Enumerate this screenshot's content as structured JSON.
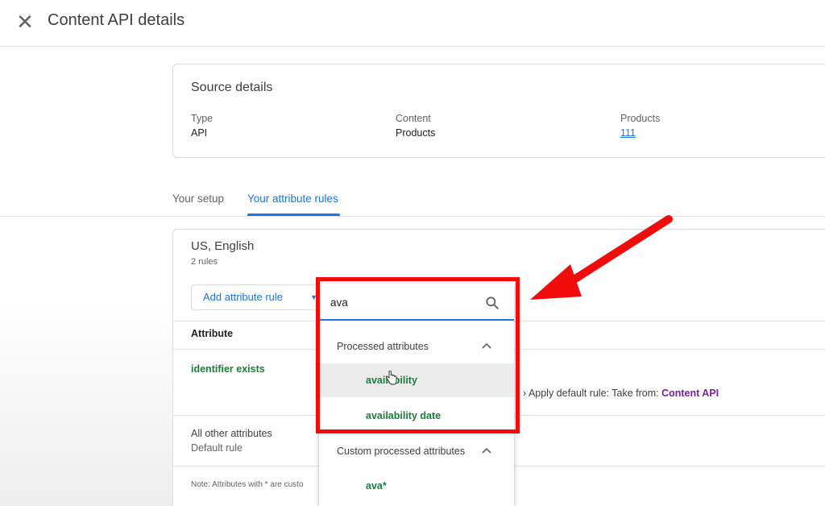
{
  "header": {
    "close_label": "✕",
    "title": "Content API details"
  },
  "source_details": {
    "heading": "Source details",
    "type_label": "Type",
    "type_value": "API",
    "content_label": "Content",
    "content_value": "Products",
    "products_label": "Products",
    "products_value": "111"
  },
  "tabs": [
    {
      "label": "Your setup",
      "active": false
    },
    {
      "label": "Your attribute rules",
      "active": true
    }
  ],
  "rules_panel": {
    "region": "US, English",
    "rules_count": "2 rules",
    "add_button_label": "Add attribute rule",
    "column_header": "Attribute",
    "rows": [
      {
        "attribute": "identifier exists",
        "rule_prefix": "› Apply default rule: Take from: ",
        "rule_source": "Content API"
      }
    ],
    "other_attributes_label": "All other attributes",
    "default_rule_label": "Default rule",
    "note": "Note: Attributes with * are custo"
  },
  "dropdown": {
    "search_value": "ava",
    "groups": [
      {
        "label": "Processed attributes",
        "options": [
          {
            "label": "availability",
            "hovered": true
          },
          {
            "label": "availability date",
            "hovered": false
          }
        ]
      },
      {
        "label": "Custom processed attributes",
        "options": [
          {
            "label": "ava*",
            "hovered": false
          }
        ]
      }
    ]
  },
  "annotation": {
    "highlight_color": "#f20b0b",
    "arrow_color": "#f20b0b"
  },
  "colors": {
    "accent": "#1a73e8",
    "attribute_green": "#188038",
    "link_purple": "#7b1fa2"
  }
}
